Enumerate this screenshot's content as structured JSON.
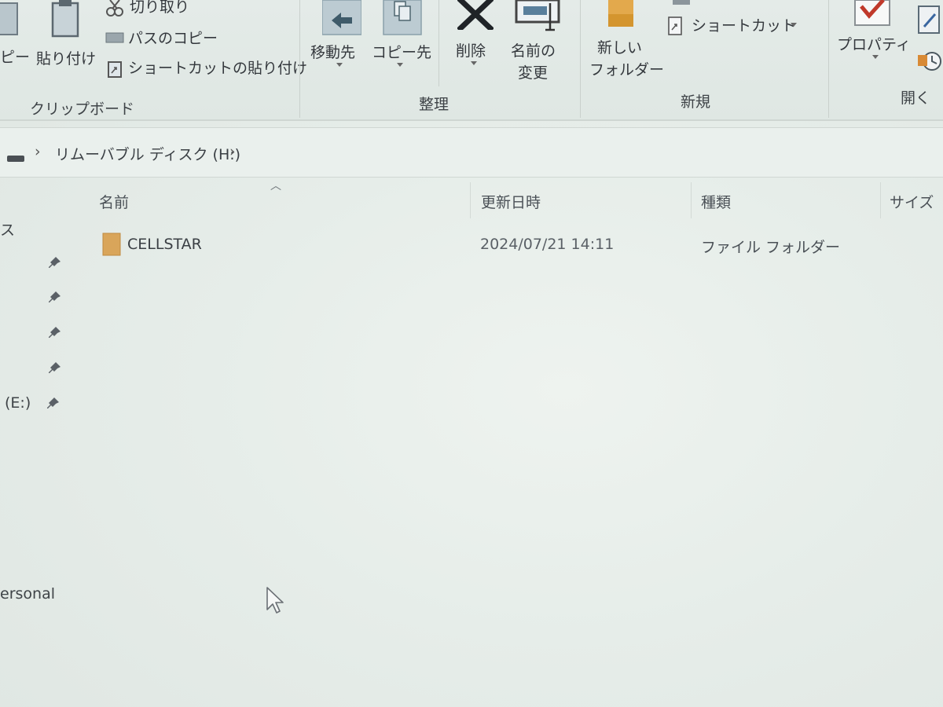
{
  "ribbon": {
    "clipboard": {
      "copy_partial": "ピー",
      "paste": "貼り付け",
      "cut": "切り取り",
      "copy_path": "パスのコピー",
      "paste_shortcut": "ショートカットの貼り付け",
      "group_label": "クリップボード"
    },
    "organize": {
      "move_to": "移動先",
      "copy_to": "コピー先",
      "delete": "削除",
      "rename_line1": "名前の",
      "rename_line2": "変更",
      "group_label": "整理"
    },
    "new": {
      "new_folder_line1": "新しい",
      "new_folder_line2": "フォルダー",
      "shortcut": "ショートカット",
      "group_label": "新規"
    },
    "open": {
      "properties": "プロパティ",
      "group_label": "開く"
    }
  },
  "address_bar": {
    "path": "リムーバブル ディスク (H:)"
  },
  "columns": {
    "name": "名前",
    "modified": "更新日時",
    "type": "種類",
    "size": "サイズ"
  },
  "nav_pane": {
    "partial_top": "ス",
    "drive_e": "(E:)",
    "partial_bottom": "ersonal"
  },
  "files": [
    {
      "name": "CELLSTAR",
      "modified": "2024/07/21 14:11",
      "type": "ファイル フォルダー"
    }
  ],
  "colors": {
    "folder": "#d9a55a",
    "delete_x": "#1f2327",
    "checkmark": "#c0392b"
  }
}
